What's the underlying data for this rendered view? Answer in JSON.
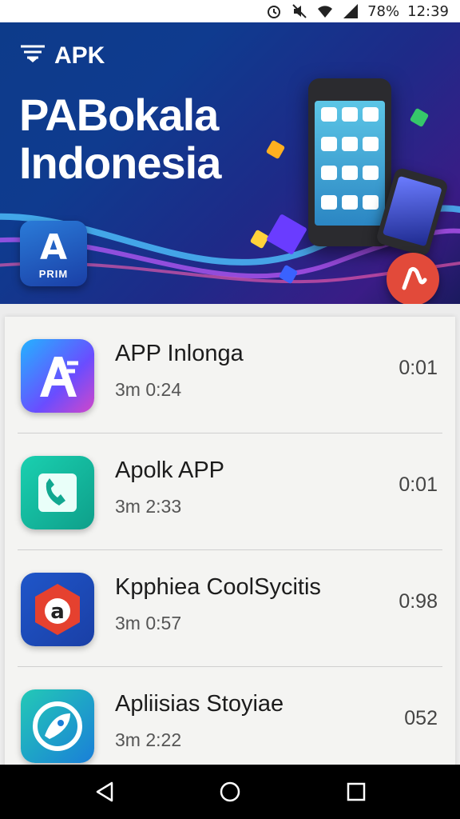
{
  "status_bar": {
    "battery": "78%",
    "time": "12:39"
  },
  "banner": {
    "brand": "APK",
    "title_line1": "PABokala",
    "title_line2": "Indonesia",
    "badge_small": "PRIM"
  },
  "apps": [
    {
      "title": "APP Inlonga",
      "subtitle": "3m 0:24",
      "time": "0:01"
    },
    {
      "title": "Apolk APP",
      "subtitle": "3m 2:33",
      "time": "0:01"
    },
    {
      "title": "Kpphiea CoolSycitis",
      "subtitle": "3m 0:57",
      "time": "0:98"
    },
    {
      "title": "Apliisias Stoyiae",
      "subtitle": "3m 2:22",
      "time": "052"
    }
  ],
  "colors": {
    "banner_blue": "#0f3b8f",
    "accent_red": "#e24a3a",
    "nav_bar": "#000000"
  },
  "icons": [
    "alarm-icon",
    "mute-icon",
    "wifi-icon",
    "signal-icon",
    "back-icon",
    "home-icon",
    "recents-icon"
  ]
}
